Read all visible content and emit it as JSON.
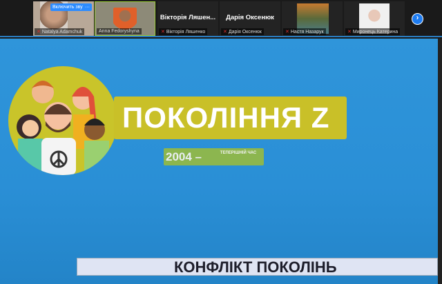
{
  "participants": [
    {
      "name": "Natalya Adamchuk",
      "video": true
    },
    {
      "name": "Anna Fedoryshyna",
      "video": true
    },
    {
      "name": "Вікторія Ляшенко",
      "display": "Вікторія Ляшен...",
      "video": false
    },
    {
      "name": "Дарія Оксенюк",
      "display": "Дарія Оксенюк",
      "video": false
    },
    {
      "name": "Настя Назарук",
      "video": true
    },
    {
      "name": "Миронець Катерина",
      "video": true
    }
  ],
  "controls": {
    "unmute_label": "Включить звук",
    "more_label": "···",
    "next_label": "›"
  },
  "slide": {
    "title": "ПОКОЛІННЯ Z",
    "year": "2004 –",
    "now": "ТЕПЕРІШНІЙ ЧАС",
    "subtitle": "КОНФЛІКТ ПОКОЛІНЬ"
  },
  "colors": {
    "slide_bg": "#2a8fd6",
    "accent_yellow": "#c9c028",
    "badge_green": "#8cb64f"
  }
}
